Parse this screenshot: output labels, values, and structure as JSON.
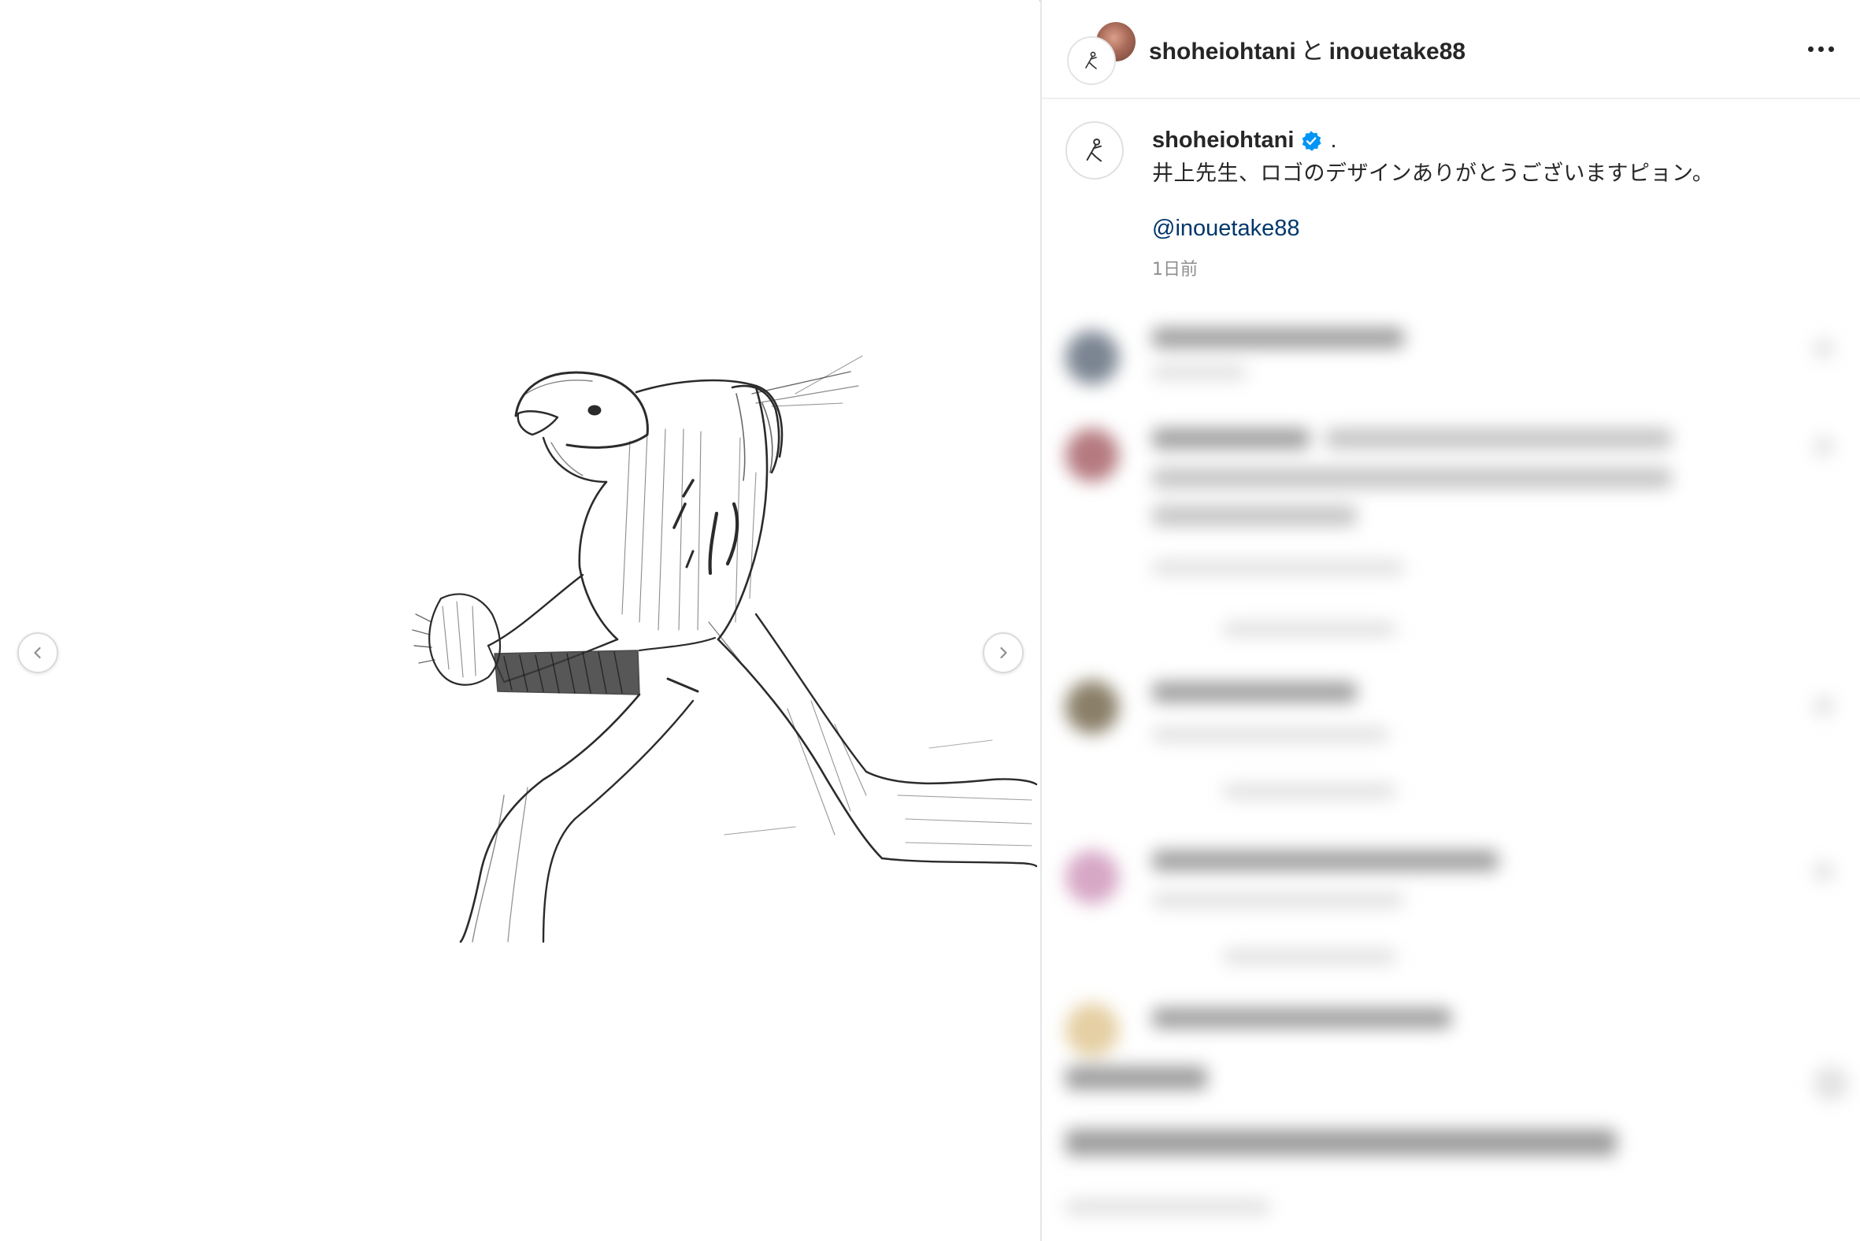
{
  "header": {
    "user_primary": "shoheiohtani",
    "joiner": "と",
    "user_secondary": "inouetake88"
  },
  "caption": {
    "username": "shoheiohtani",
    "after_name": ".",
    "text": "井上先生、ロゴのデザインありがとうございますピョン。",
    "mention": "@inouetake88",
    "timestamp": "1日前"
  },
  "icons": {
    "prev": "chevron-left-icon",
    "next": "chevron-right-icon",
    "more": "more-horizontal-icon",
    "verified": "verified-badge-icon"
  },
  "colors": {
    "text": "#262626",
    "link": "#00376b",
    "muted": "#8e8e8e",
    "verified": "#0095f6",
    "divider": "#efefef"
  }
}
